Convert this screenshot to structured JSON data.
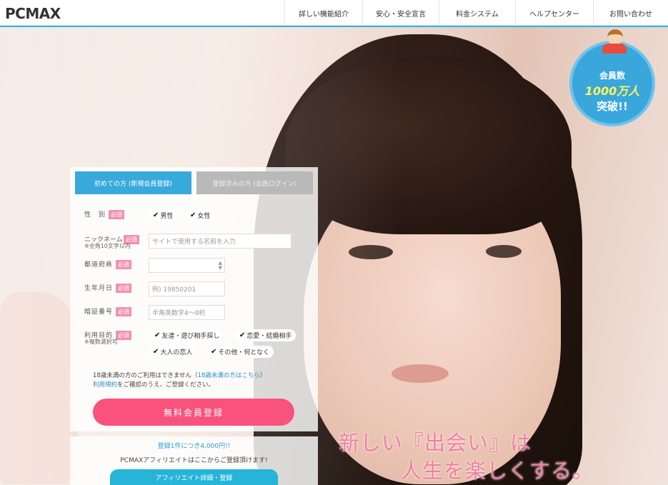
{
  "header": {
    "logo_text": "PCMAX",
    "nav": [
      "詳しい機能紹介",
      "安心・安全宣言",
      "料金システム",
      "ヘルプセンター",
      "お問い合わせ"
    ]
  },
  "hero": {
    "tagline_1": "新しい『出会い』は",
    "tagline_2": "人生を楽しくする。"
  },
  "badge": {
    "line1": "会員数",
    "line2": "1000万人",
    "line3": "突破!!"
  },
  "form": {
    "tab_new": "初めての方 (新規会員登録)",
    "tab_login": "登録済みの方 (会員ログイン)",
    "required_label": "必須",
    "gender_label": "性　別",
    "gender_options": [
      "男性",
      "女性"
    ],
    "nickname_label": "ニックネーム",
    "nickname_note": "※全角10文字以内",
    "nickname_placeholder": "サイトで使用する名前を入力",
    "prefecture_label": "都道府県",
    "prefecture_value": "",
    "birthday_label": "生年月日",
    "birthday_placeholder": "例) 19850201",
    "pin_label": "暗証番号",
    "pin_placeholder": "半角英数字4〜8桁",
    "purpose_label": "利用目的",
    "purpose_note": "※複数選択可",
    "purpose_options": [
      "友達・遊び相手探し",
      "恋愛・結婚相手",
      "大人の恋人",
      "その他・何となく"
    ],
    "notice_1a": "18歳未満の方のご利用はできません（",
    "notice_1_link": "18歳未満の方はこちら",
    "notice_1b": "）",
    "notice_2_link": "利用規約",
    "notice_2b": "をご確認のうえ、ご登録ください。",
    "submit_label": "無料会員登録"
  },
  "affiliate": {
    "line1": "登録1件につき4,000円!!",
    "line2": "PCMAXアフィリエイトはここからご登録頂けます!",
    "button_label": "アフィリエイト詳細・登録"
  },
  "colors": {
    "accent_blue": "#2bb6e6",
    "submit_pink": "#f9527c",
    "required_pink": "#f390b0",
    "tagline_pink": "#f07fa0"
  }
}
